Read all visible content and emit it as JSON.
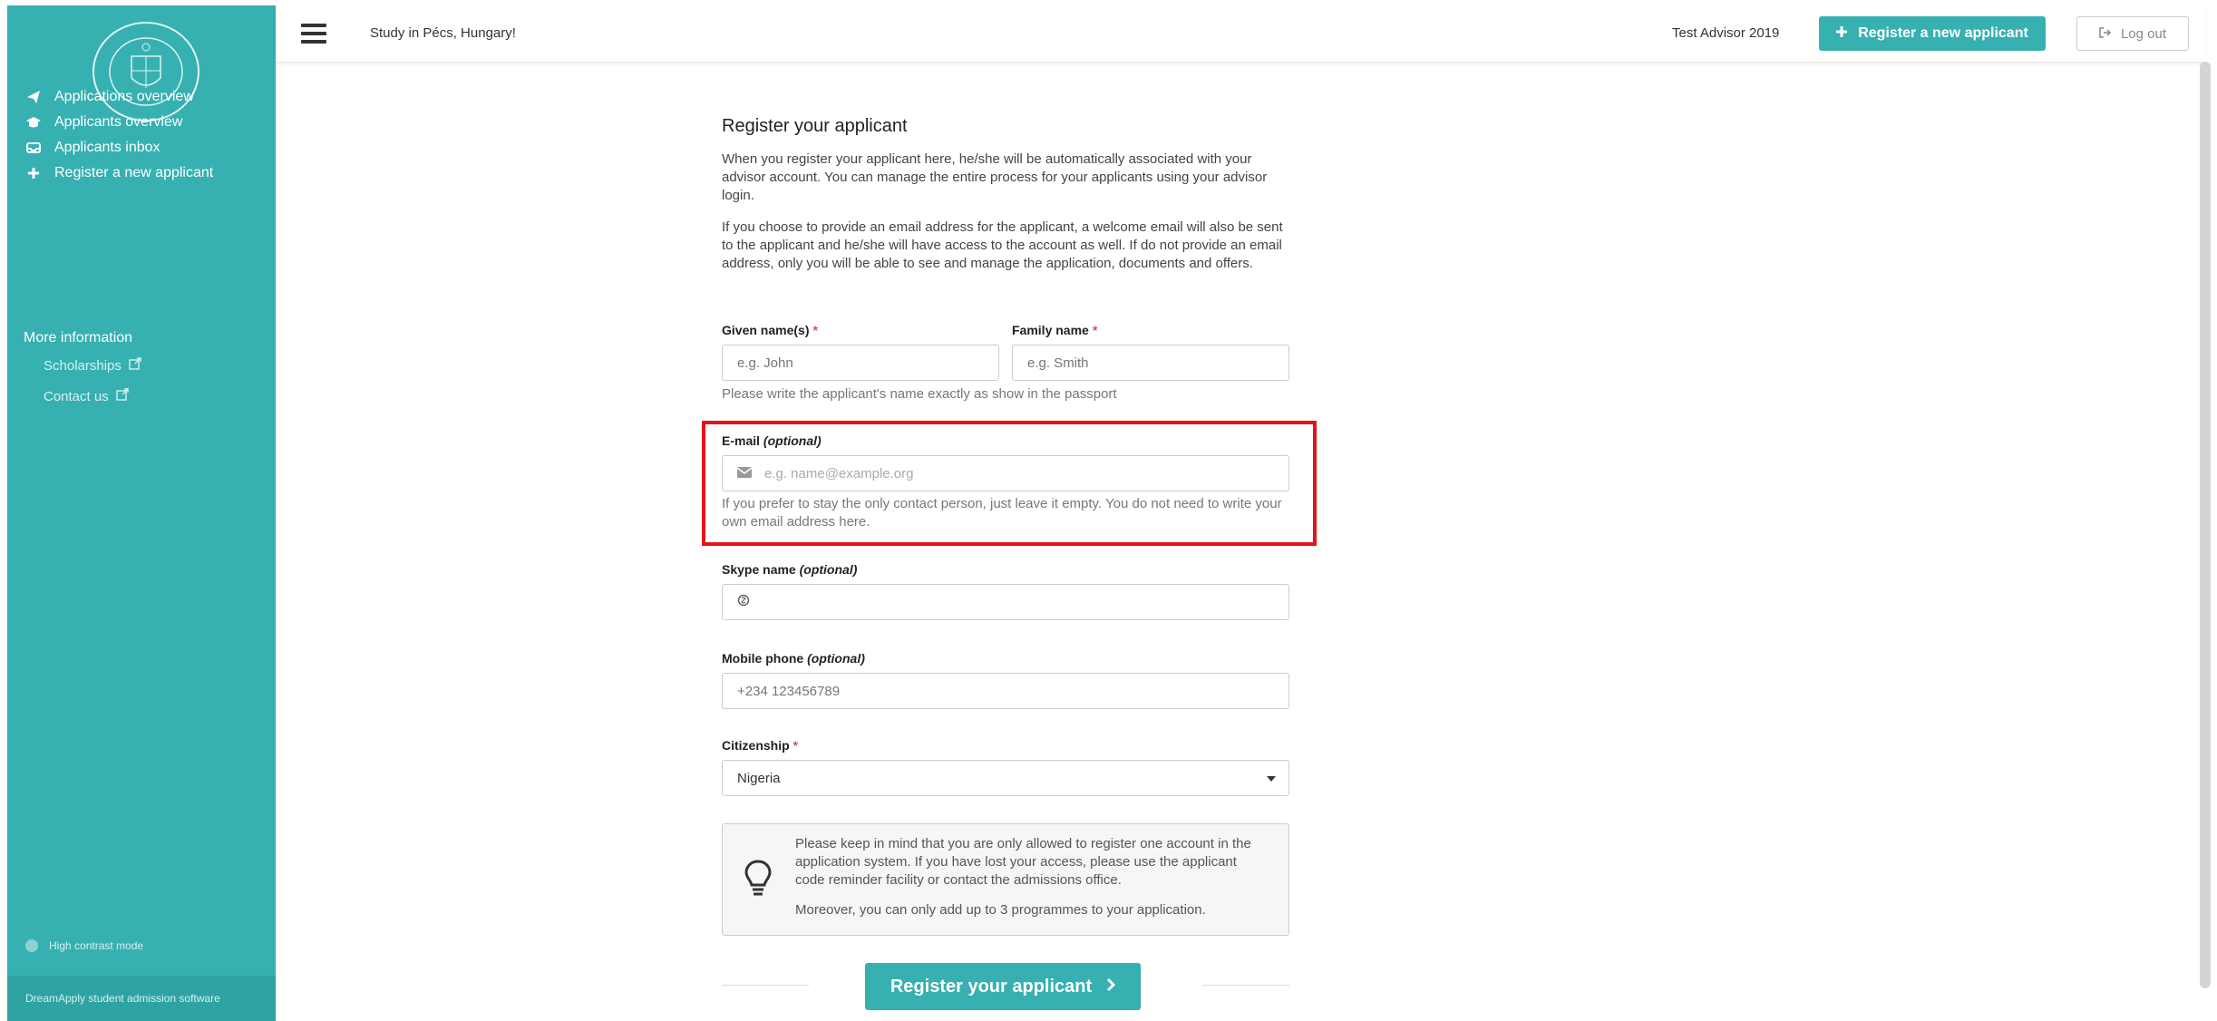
{
  "colors": {
    "brand": "#36b0b1",
    "highlight": "#e3141b",
    "required": "#e34a4a"
  },
  "sidebar": {
    "logo_icon": "university-seal",
    "items": [
      {
        "label": "Applications overview",
        "icon": "paper-plane-icon"
      },
      {
        "label": "Applicants overview",
        "icon": "graduation-cap-icon"
      },
      {
        "label": "Applicants inbox",
        "icon": "inbox-icon"
      },
      {
        "label": "Register a new applicant",
        "icon": "plus-icon"
      }
    ],
    "more_title": "More information",
    "links": [
      {
        "label": "Scholarships"
      },
      {
        "label": "Contact us"
      }
    ],
    "high_contrast": "High contrast mode",
    "footer": "DreamApply student admission software"
  },
  "topbar": {
    "title": "Study in Pécs, Hungary!",
    "advisor": "Test Advisor 2019",
    "register_button": "Register a new applicant",
    "logout_button": "Log out"
  },
  "form": {
    "title": "Register your applicant",
    "intro1": "When you register your applicant here, he/she will be automatically associated with your advisor account. You can manage the entire process for your applicants using your advisor login.",
    "intro2": "If you choose to provide an email address for the applicant, a welcome email will also be sent to the applicant and he/she will have access to the account as well. If do not provide an email address, only you will be able to see and manage the application, documents and offers.",
    "given_name": {
      "label": "Given name(s)",
      "placeholder": "e.g. John"
    },
    "family_name": {
      "label": "Family name",
      "placeholder": "e.g. Smith"
    },
    "name_help": "Please write the applicant's name exactly as show in the passport",
    "email": {
      "label": "E-mail",
      "optional": "(optional)",
      "placeholder": "e.g. name@example.org",
      "help": "If you prefer to stay the only contact person, just leave it empty. You do not need to write your own email address here."
    },
    "skype": {
      "label": "Skype name",
      "optional": "(optional)",
      "value": ""
    },
    "mobile": {
      "label": "Mobile phone",
      "optional": "(optional)",
      "placeholder": "+234 123456789"
    },
    "citizenship": {
      "label": "Citizenship",
      "value": "Nigeria"
    },
    "notice1": "Please keep in mind that you are only allowed to register one account in the application system. If you have lost your access, please use the applicant code reminder facility or contact the admissions office.",
    "notice2": "Moreover, you can only add up to 3 programmes to your application.",
    "submit": "Register your applicant"
  }
}
